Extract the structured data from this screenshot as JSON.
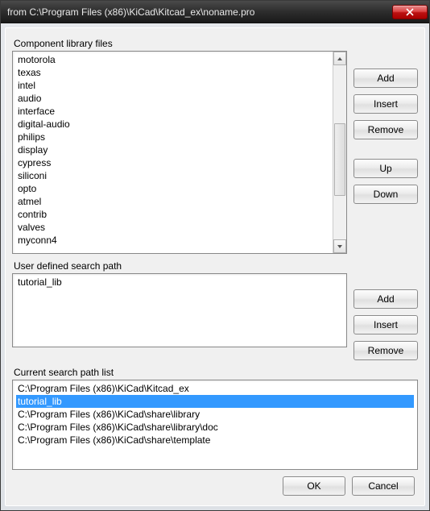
{
  "title": "from C:\\Program Files (x86)\\KiCad\\Kitcad_ex\\noname.pro",
  "sections": {
    "component": {
      "label": "Component library files",
      "items": [
        "motorola",
        "texas",
        "intel",
        "audio",
        "interface",
        "digital-audio",
        "philips",
        "display",
        "cypress",
        "siliconi",
        "opto",
        "atmel",
        "contrib",
        "valves",
        "myconn4"
      ],
      "buttons": {
        "add": "Add",
        "insert": "Insert",
        "remove": "Remove",
        "up": "Up",
        "down": "Down"
      }
    },
    "user": {
      "label": "User defined search path",
      "items": [
        "tutorial_lib"
      ],
      "buttons": {
        "add": "Add",
        "insert": "Insert",
        "remove": "Remove"
      }
    },
    "search": {
      "label": "Current search path list",
      "items": [
        "C:\\Program Files (x86)\\KiCad\\Kitcad_ex",
        "tutorial_lib",
        "C:\\Program Files (x86)\\KiCad\\share\\library",
        "C:\\Program Files (x86)\\KiCad\\share\\library\\doc",
        "C:\\Program Files (x86)\\KiCad\\share\\template"
      ],
      "selected_index": 1
    }
  },
  "footer": {
    "ok": "OK",
    "cancel": "Cancel"
  }
}
